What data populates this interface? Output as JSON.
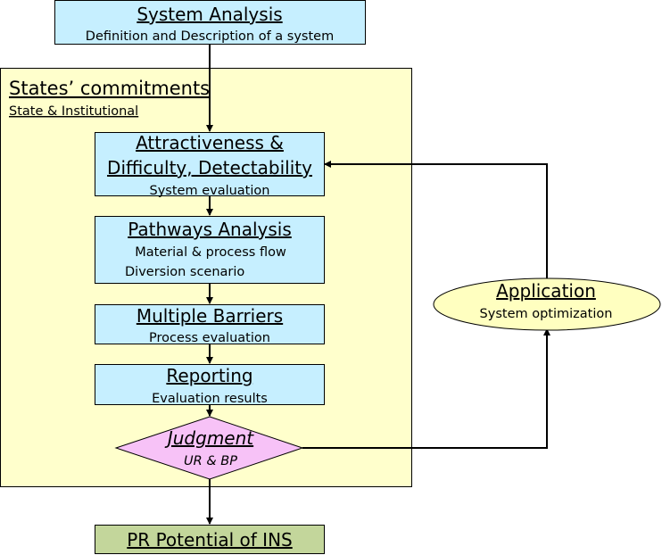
{
  "colors": {
    "process_box": "#c6efff",
    "container": "#ffffcc",
    "decision": "#f7c2f7",
    "terminal": "#c3d69b",
    "application": "#ffffc0"
  },
  "nodes": {
    "system_analysis": {
      "title": "System Analysis",
      "subtitle": "Definition and Description of a system"
    },
    "states_commitments": {
      "title": "States’ commitments",
      "subtitle": "State & Institutional"
    },
    "attractiveness": {
      "title_line1": "Attractiveness &",
      "title_line2": "Difficulty, Detectability",
      "subtitle": "System evaluation"
    },
    "pathways": {
      "title": "Pathways Analysis",
      "subtitle_line1": "Material & process flow",
      "subtitle_line2": "Diversion scenario"
    },
    "barriers": {
      "title": "Multiple Barriers",
      "subtitle": "Process evaluation"
    },
    "reporting": {
      "title": "Reporting",
      "subtitle": "Evaluation results"
    },
    "judgment": {
      "title": "Judgment",
      "subtitle": "UR & BP"
    },
    "application": {
      "title": "Application",
      "subtitle": "System optimization"
    },
    "pr_potential": {
      "title": "PR Potential of INS"
    }
  }
}
